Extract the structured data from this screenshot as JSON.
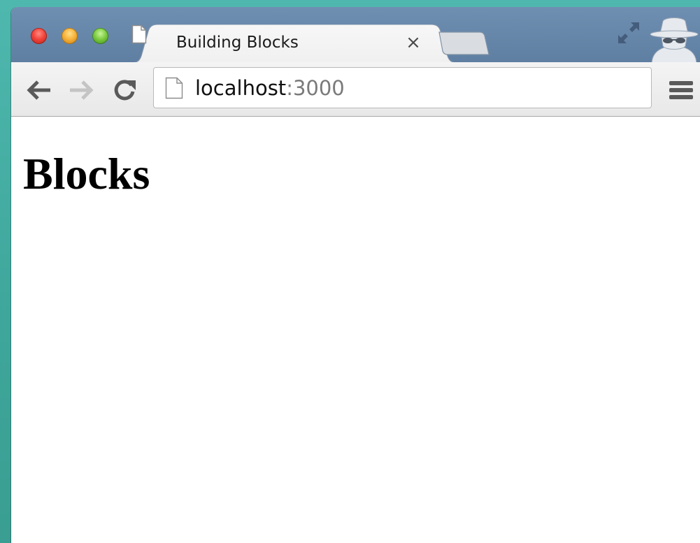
{
  "browser": {
    "tab": {
      "title": "Building Blocks",
      "close_glyph": "×",
      "icon": "document-icon"
    },
    "new_tab_icon": "new-tab-icon",
    "fullscreen_icon": "fullscreen-icon",
    "profile_icon": "incognito-icon",
    "address_bar": {
      "host": "localhost",
      "port": ":3000",
      "icon": "document-icon"
    },
    "nav_icons": [
      "back-arrow-icon",
      "forward-arrow-icon",
      "reload-icon"
    ],
    "menu_icon": "menu-icon"
  },
  "page": {
    "heading": "Blocks"
  },
  "colors": {
    "desktop": "#4fb8ae",
    "titlebar": "#6f8fb2",
    "toolbar": "#f0f0f0",
    "port_text": "#7a7a7a"
  }
}
